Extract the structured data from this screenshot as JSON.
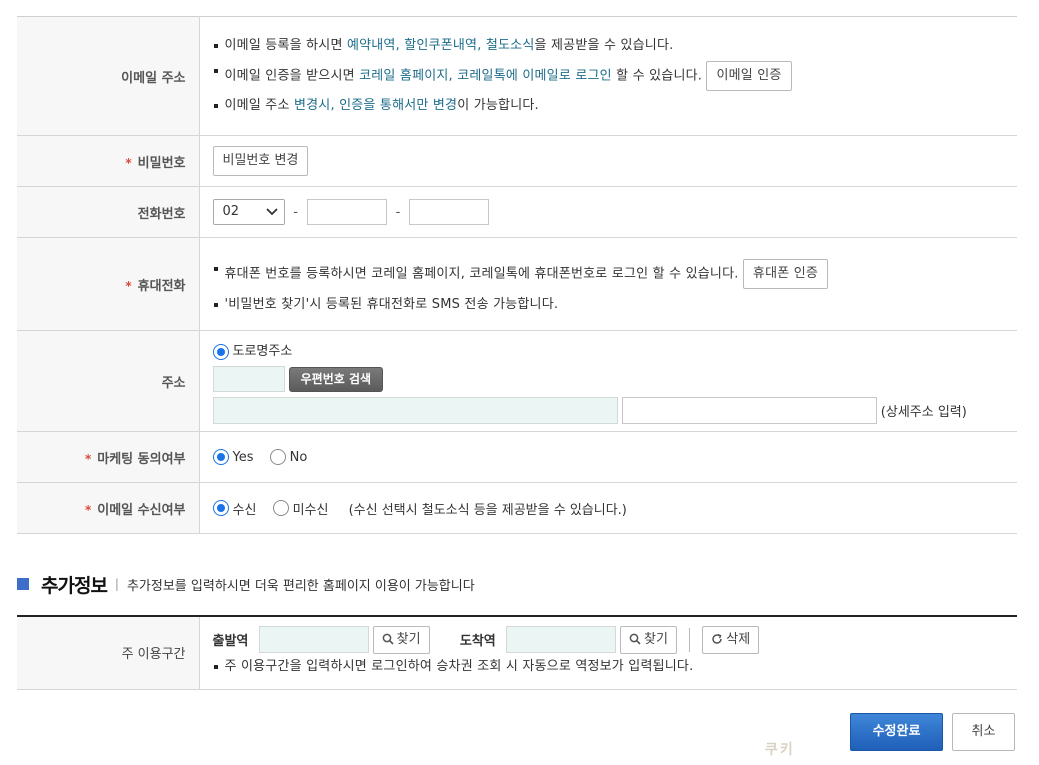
{
  "email": {
    "label": "이메일 주소",
    "line1": {
      "pre": "이메일 등록을 하시면 ",
      "hl": "예약내역, 할인쿠폰내역, 철도소식",
      "post": "을 제공받을 수 있습니다."
    },
    "line2": {
      "pre": "이메일 인증을 받으시면 ",
      "hl": "코레일 홈페이지, 코레일톡에 이메일로 로그인",
      "post": " 할 수 있습니다."
    },
    "verify_button": "이메일 인증",
    "line3": {
      "pre": "이메일 주소 ",
      "hl": "변경시, 인증을 통해서만 변경",
      "post": "이 가능합니다."
    }
  },
  "password": {
    "label": "비밀번호",
    "required": "*",
    "change_button": "비밀번호 변경"
  },
  "phone": {
    "label": "전화번호",
    "area_code": "02",
    "dash": "-"
  },
  "mobile": {
    "label": "휴대전화",
    "required": "*",
    "line1": "휴대폰 번호를 등록하시면 코레일 홈페이지, 코레일톡에 휴대폰번호로 로그인 할 수 있습니다.",
    "verify_button": "휴대폰 인증",
    "line2": "'비밀번호 찾기'시 등록된 휴대전화로 SMS 전송 가능합니다."
  },
  "address": {
    "label": "주소",
    "radio_road": "도로명주소",
    "zip_button": "우편번호 검색",
    "detail_hint": "(상세주소 입력)"
  },
  "marketing": {
    "label": "마케팅 동의여부",
    "required": "*",
    "yes": "Yes",
    "no": "No"
  },
  "email_receive": {
    "label": "이메일 수신여부",
    "required": "*",
    "receive": "수신",
    "not_receive": "미수신",
    "note": "(수신 선택시 철도소식 등을 제공받을 수 있습니다.)"
  },
  "extra": {
    "title": "추가정보",
    "separator": "|",
    "description": "추가정보를 입력하시면 더욱 편리한 홈페이지 이용이 가능합니다",
    "route_label": "주 이용구간",
    "departure_label": "출발역",
    "arrival_label": "도착역",
    "find_button": "찾기",
    "delete_button": "삭제",
    "route_note": "주 이용구간을 입력하시면 로그인하여 승차권 조회 시 자동으로 역정보가 입력됩니다."
  },
  "actions": {
    "submit": "수정완료",
    "cancel": "취소"
  },
  "watermark": "쿠키",
  "colors": {
    "highlight": "#1d6c8a",
    "required": "#d84a3a",
    "primary": "#1f5fb8",
    "radio": "#1a73e8",
    "section_square": "#3d6ec9"
  }
}
